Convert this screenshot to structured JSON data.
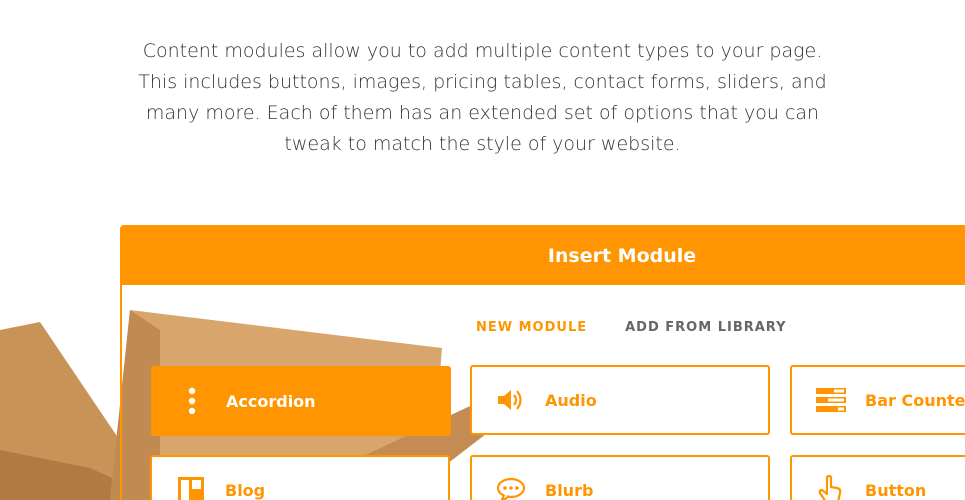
{
  "intro": {
    "lines": [
      "Content modules allow you to add multiple content types to your page.",
      "This includes buttons, images, pricing tables, contact forms, sliders, and",
      "many more. Each of them has an extended set of options that you can",
      "tweak to match the style of your website."
    ]
  },
  "modal": {
    "title": "Insert Module",
    "tabs": [
      {
        "label": "NEW MODULE",
        "active": true
      },
      {
        "label": "ADD FROM LIBRARY",
        "active": false
      }
    ],
    "modules": [
      {
        "label": "Accordion",
        "icon": "vertical-dots-icon",
        "selected": true
      },
      {
        "label": "Audio",
        "icon": "speaker-icon",
        "selected": false
      },
      {
        "label": "Bar Counters",
        "icon": "bar-counters-icon",
        "selected": false
      },
      {
        "label": "Blog",
        "icon": "blog-layout-icon",
        "selected": false
      },
      {
        "label": "Blurb",
        "icon": "speech-bubble-icon",
        "selected": false
      },
      {
        "label": "Button",
        "icon": "pointer-hand-icon",
        "selected": false
      }
    ]
  },
  "colors": {
    "accent": "#ff9500",
    "text": "#333333",
    "tab_inactive": "#666666"
  }
}
